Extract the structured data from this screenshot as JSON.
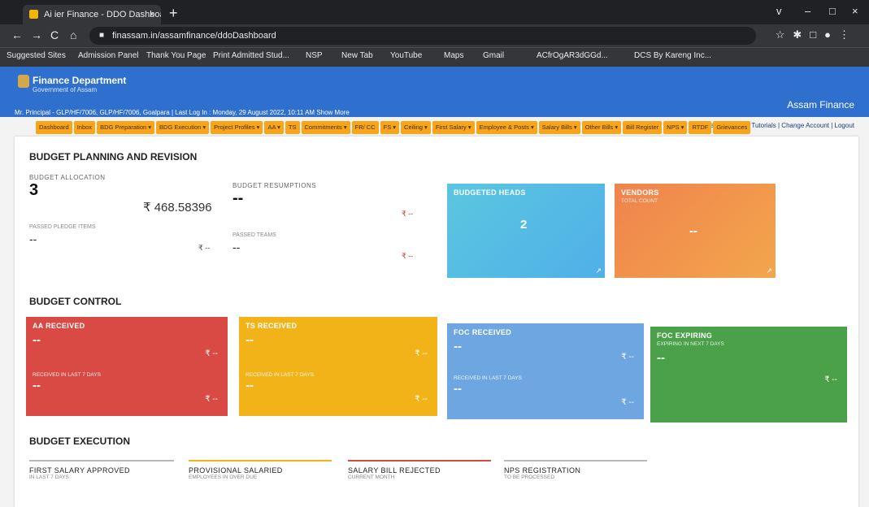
{
  "browser": {
    "tab_title": "Ai ier Finance - DDO Dashboard",
    "tab_close": "×",
    "new_tab": "+",
    "url": "finassam.in/assamfinance/ddoDashboard",
    "window_controls": [
      "v",
      "–",
      "□",
      "×"
    ],
    "nav": [
      "←",
      "→",
      "C",
      "⌂"
    ],
    "bookmarks": [
      "Suggested Sites",
      "Admission Panel",
      "Thank You Page",
      "Print Admitted Stud...",
      "NSP",
      "New Tab",
      "YouTube",
      "Maps",
      "Gmail",
      "ACfrOgAR3dGGd...",
      "DCS By Kareng Inc..."
    ]
  },
  "header": {
    "department": "Finance Department",
    "government": "Government of Assam",
    "brand": "Assam Finance",
    "user_line": "Mr. Principal - GLP/HF/7006, GLP/HF/7006, Goalpara  |  Last Log In : Monday, 29 August 2022, 10:11 AM Show More",
    "top_links": "⌂ Home  |  Manuals & Tutorials  |  Change Account  |  Logout"
  },
  "menu": [
    "Dashboard",
    "Inbox",
    "BDG Preparation ▾",
    "BDG Execution ▾",
    "Project Profiles ▾",
    "AA ▾",
    "TS",
    "Commitments ▾",
    "FR/ CC",
    "FS ▾",
    "Ceiling ▾",
    "First Salary ▾",
    "Employee & Posts ▾",
    "Salary Bills ▾",
    "Other Bills ▾",
    "Bill Register",
    "NPS ▾",
    "RTDF",
    "Grievances"
  ],
  "budget_planning": {
    "heading": "BUDGET PLANNING AND REVISION",
    "allocation_label": "BUDGET ALLOCATION",
    "allocation_count": "3",
    "allocation_amount": "₹ 468.58396",
    "allocation_sub": "PASSED PLEDGE ITEMS",
    "allocation_sub_val": "--",
    "allocation_sub_amt": "₹ --",
    "resumption_label": "BUDGET RESUMPTIONS",
    "resumption_val": "--",
    "resumption_amt": "₹ --",
    "resumption_sub": "PASSED TEAMS",
    "resumption_sub_val": "--",
    "resumption_sub_amt": "₹ --",
    "heads_title": "BUDGETED HEADS",
    "heads_val": "2",
    "vendors_title": "VENDORS",
    "vendors_sub": "TOTAL COUNT",
    "vendors_val": "--"
  },
  "budget_control": {
    "heading": "BUDGET CONTROL",
    "cards": [
      {
        "title": "AA RECEIVED",
        "val": "--",
        "amt": "₹ --",
        "sub": "RECEIVED IN LAST 7 DAYS",
        "sub_val": "--",
        "sub_amt": "₹ --",
        "color": "#d84a43"
      },
      {
        "title": "TS RECEIVED",
        "val": "--",
        "amt": "₹ --",
        "sub": "RECEIVED IN LAST 7 DAYS",
        "sub_val": "--",
        "sub_amt": "₹ --",
        "color": "#f2b319"
      },
      {
        "title": "FOC RECEIVED",
        "val": "--",
        "amt": "₹ --",
        "sub": "RECEIVED IN LAST 7 DAYS",
        "sub_val": "--",
        "sub_amt": "₹ --",
        "color": "#6ea6e2"
      },
      {
        "title": "FOC EXPIRING",
        "subtitle": "EXPIRING IN NEXT 7 DAYS",
        "val": "--",
        "amt": "₹ --",
        "color": "#4aa149"
      }
    ]
  },
  "budget_execution": {
    "heading": "BUDGET EXECUTION",
    "items": [
      {
        "title": "FIRST SALARY APPROVED",
        "sub": "IN LAST 7 DAYS"
      },
      {
        "title": "PROVISIONAL SALARIED",
        "sub": "EMPLOYEES IN OVER DUE"
      },
      {
        "title": "SALARY BILL REJECTED",
        "sub": "CURRENT MONTH"
      },
      {
        "title": "NPS REGISTRATION",
        "sub": "TO BE PROCESSED"
      }
    ]
  },
  "colors": {
    "header_blue": "#2f6fce",
    "menu_orange": "#f8a51a",
    "heads_card": "#4fc6dd",
    "vendors_card": "#f08a4b"
  }
}
